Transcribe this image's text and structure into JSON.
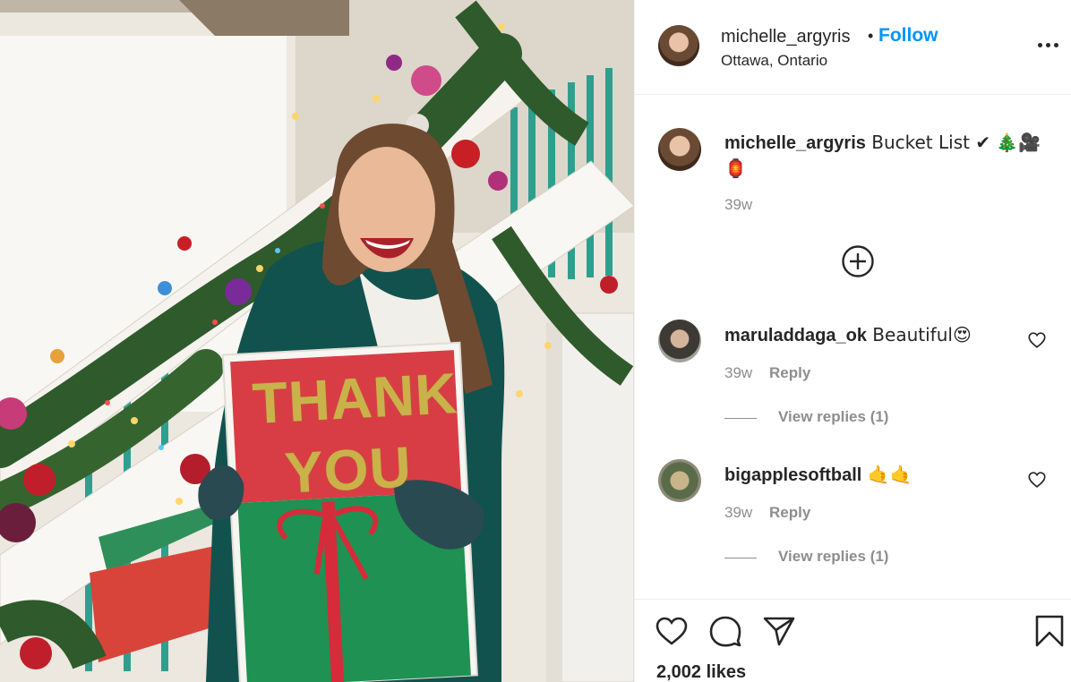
{
  "post": {
    "photo": {
      "sign_line1": "THANK",
      "sign_line2": "YOU"
    }
  },
  "header": {
    "username": "michelle_argyris",
    "dot": "•",
    "follow_label": "Follow",
    "location": "Ottawa, Ontario"
  },
  "caption": {
    "username": "michelle_argyris",
    "text": " Bucket List ✔ 🎄🎥",
    "text_line2": "🏮",
    "time": "39w"
  },
  "comments": [
    {
      "username": "maruladdaga_ok",
      "text": " Beautiful😍",
      "time": "39w",
      "reply_label": "Reply",
      "view_replies": "View replies (1)"
    },
    {
      "username": "bigapplesoftball",
      "text": " 🤙🤙",
      "time": "39w",
      "reply_label": "Reply",
      "view_replies": "View replies (1)"
    }
  ],
  "footer": {
    "likes": "2,002 likes"
  },
  "colors": {
    "accent": "#0095f6",
    "text": "#262626",
    "muted": "#8e8e8e",
    "border": "#efefef"
  }
}
